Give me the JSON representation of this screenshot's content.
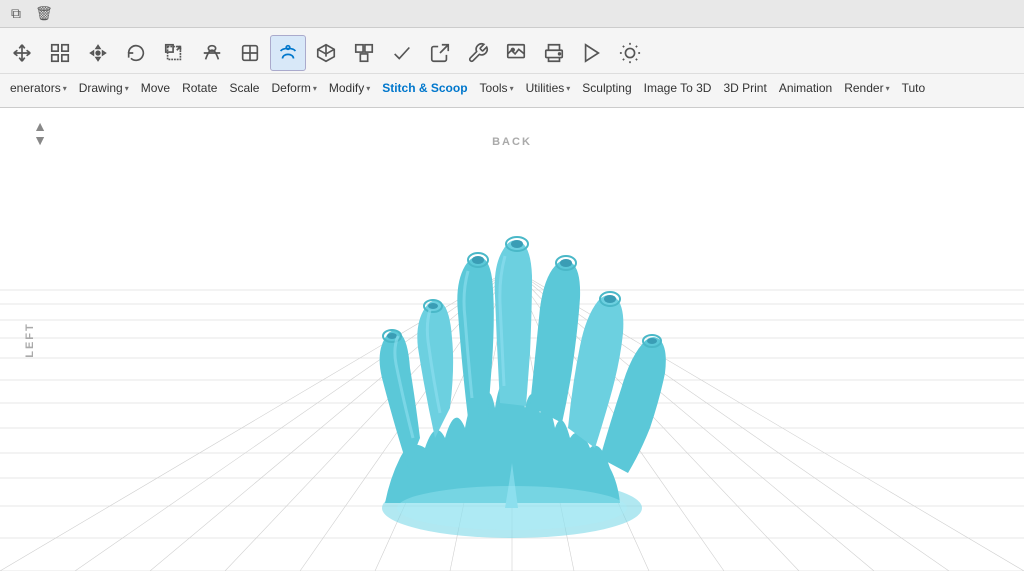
{
  "titlebar": {
    "icon_copy": "⧉",
    "icon_trash": "🗑"
  },
  "toolbar": {
    "icons": [
      {
        "name": "move-icon",
        "label": "Move"
      },
      {
        "name": "layers-icon",
        "label": "Layers"
      },
      {
        "name": "translate-icon",
        "label": "Translate"
      },
      {
        "name": "rotate-icon",
        "label": "Rotate"
      },
      {
        "name": "scale-icon",
        "label": "Scale"
      },
      {
        "name": "deform-icon",
        "label": "Deform"
      },
      {
        "name": "modify-icon",
        "label": "Modify"
      },
      {
        "name": "stitch-icon",
        "label": "Stitch"
      },
      {
        "name": "cube-icon",
        "label": "Cube"
      },
      {
        "name": "group-icon",
        "label": "Group"
      },
      {
        "name": "check-icon",
        "label": "Check"
      },
      {
        "name": "export-icon",
        "label": "Export"
      },
      {
        "name": "tools-icon",
        "label": "Tools"
      },
      {
        "name": "image-icon",
        "label": "Image"
      },
      {
        "name": "print-icon",
        "label": "Print"
      },
      {
        "name": "anim-icon",
        "label": "Animation"
      },
      {
        "name": "render-icon",
        "label": "Render"
      }
    ]
  },
  "menu": {
    "items": [
      {
        "label": "enerators",
        "has_caret": true,
        "highlight": false
      },
      {
        "label": "Drawing",
        "has_caret": true,
        "highlight": false
      },
      {
        "label": "Move",
        "has_caret": false,
        "highlight": false
      },
      {
        "label": "Rotate",
        "has_caret": false,
        "highlight": false
      },
      {
        "label": "Scale",
        "has_caret": false,
        "highlight": false
      },
      {
        "label": "Deform",
        "has_caret": true,
        "highlight": false
      },
      {
        "label": "Modify",
        "has_caret": true,
        "highlight": false
      },
      {
        "label": "Stitch & Scoop",
        "has_caret": false,
        "highlight": true
      },
      {
        "label": "Tools",
        "has_caret": true,
        "highlight": false
      },
      {
        "label": "Utilities",
        "has_caret": true,
        "highlight": false
      },
      {
        "label": "Sculpting",
        "has_caret": false,
        "highlight": false
      },
      {
        "label": "Image To 3D",
        "has_caret": false,
        "highlight": false
      },
      {
        "label": "3D Print",
        "has_caret": false,
        "highlight": false
      },
      {
        "label": "Animation",
        "has_caret": false,
        "highlight": false
      },
      {
        "label": "Render",
        "has_caret": true,
        "highlight": false
      },
      {
        "label": "Tuto",
        "has_caret": false,
        "highlight": false
      }
    ]
  },
  "viewport": {
    "axis_back": "BACK",
    "axis_left": "LEFT",
    "background_color": "#ffffff",
    "grid_color": "#dddddd",
    "model_color": "#5bc8d8"
  }
}
